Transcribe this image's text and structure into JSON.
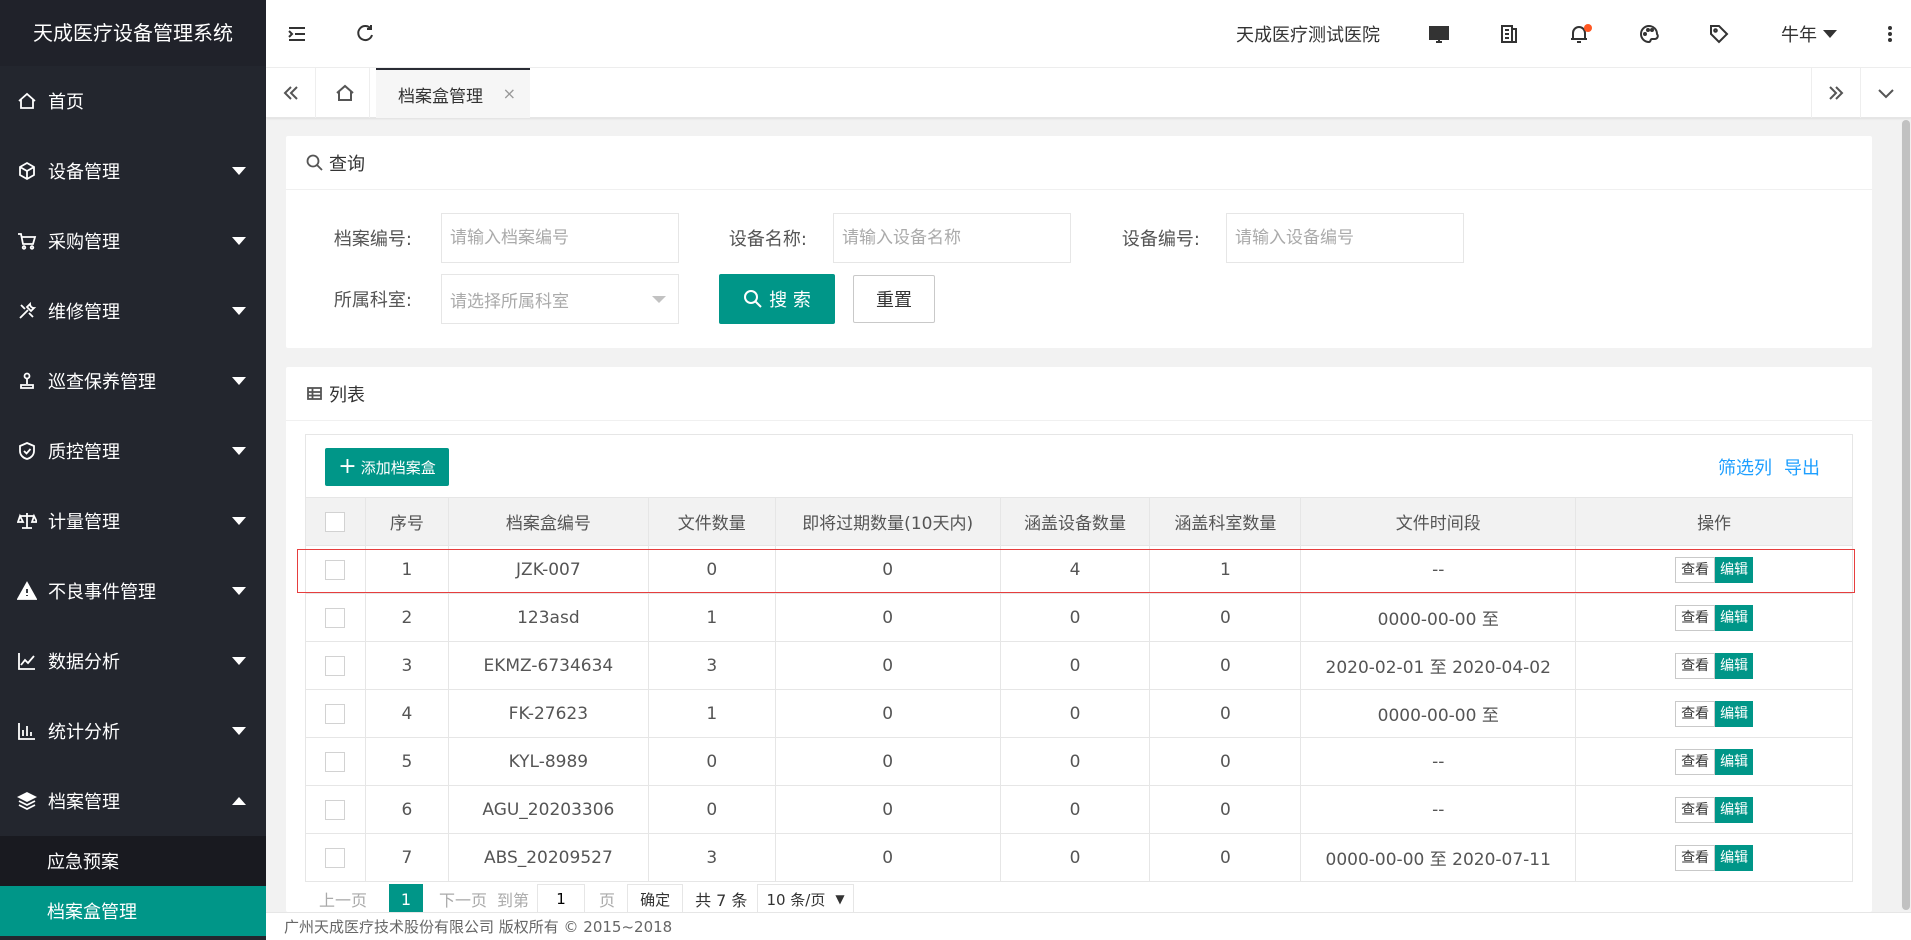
{
  "app": {
    "title": "天成医疗设备管理系统"
  },
  "sidebar": {
    "items": [
      {
        "label": "首页"
      },
      {
        "label": "设备管理"
      },
      {
        "label": "采购管理"
      },
      {
        "label": "维修管理"
      },
      {
        "label": "巡查保养管理"
      },
      {
        "label": "质控管理"
      },
      {
        "label": "计量管理"
      },
      {
        "label": "不良事件管理"
      },
      {
        "label": "数据分析"
      },
      {
        "label": "统计分析"
      },
      {
        "label": "档案管理"
      }
    ],
    "sub_items": [
      {
        "label": "应急预案"
      },
      {
        "label": "档案盒管理"
      }
    ]
  },
  "topbar": {
    "hospital": "天成医疗测试医院",
    "user": "牛年"
  },
  "tabs": {
    "active": "档案盒管理"
  },
  "query": {
    "title": "查询",
    "fields": {
      "archive_no_label": "档案编号:",
      "archive_no_placeholder": "请输入档案编号",
      "device_name_label": "设备名称:",
      "device_name_placeholder": "请输入设备名称",
      "device_no_label": "设备编号:",
      "device_no_placeholder": "请输入设备编号",
      "dept_label": "所属科室:",
      "dept_placeholder": "请选择所属科室"
    },
    "search_label": "搜 索",
    "reset_label": "重置"
  },
  "list": {
    "title": "列表",
    "add_label": "添加档案盒",
    "filter_label": "筛选列",
    "export_label": "导出",
    "columns": [
      "序号",
      "档案盒编号",
      "文件数量",
      "即将过期数量(10天内)",
      "涵盖设备数量",
      "涵盖科室数量",
      "文件时间段",
      "操作"
    ],
    "view_label": "查看",
    "edit_label": "编辑",
    "rows": [
      [
        "1",
        "JZK-007",
        "0",
        "0",
        "4",
        "1",
        "--"
      ],
      [
        "2",
        "123asd",
        "1",
        "0",
        "0",
        "0",
        "0000-00-00 至"
      ],
      [
        "3",
        "EKMZ-6734634",
        "3",
        "0",
        "0",
        "0",
        "2020-02-01 至 2020-04-02"
      ],
      [
        "4",
        "FK-27623",
        "1",
        "0",
        "0",
        "0",
        "0000-00-00 至"
      ],
      [
        "5",
        "KYL-8989",
        "0",
        "0",
        "0",
        "0",
        "--"
      ],
      [
        "6",
        "AGU_20203306",
        "0",
        "0",
        "0",
        "0",
        "--"
      ],
      [
        "7",
        "ABS_20209527",
        "3",
        "0",
        "0",
        "0",
        "0000-00-00 至 2020-07-11"
      ]
    ]
  },
  "pager": {
    "prev": "上一页",
    "current": "1",
    "next": "下一页",
    "goto": "到第",
    "page_value": "1",
    "page_unit": "页",
    "confirm": "确定",
    "total": "共 7 条",
    "size": "10 条/页"
  },
  "footer": {
    "text": "广州天成医疗技术股份有限公司 版权所有 © 2015~2018"
  }
}
